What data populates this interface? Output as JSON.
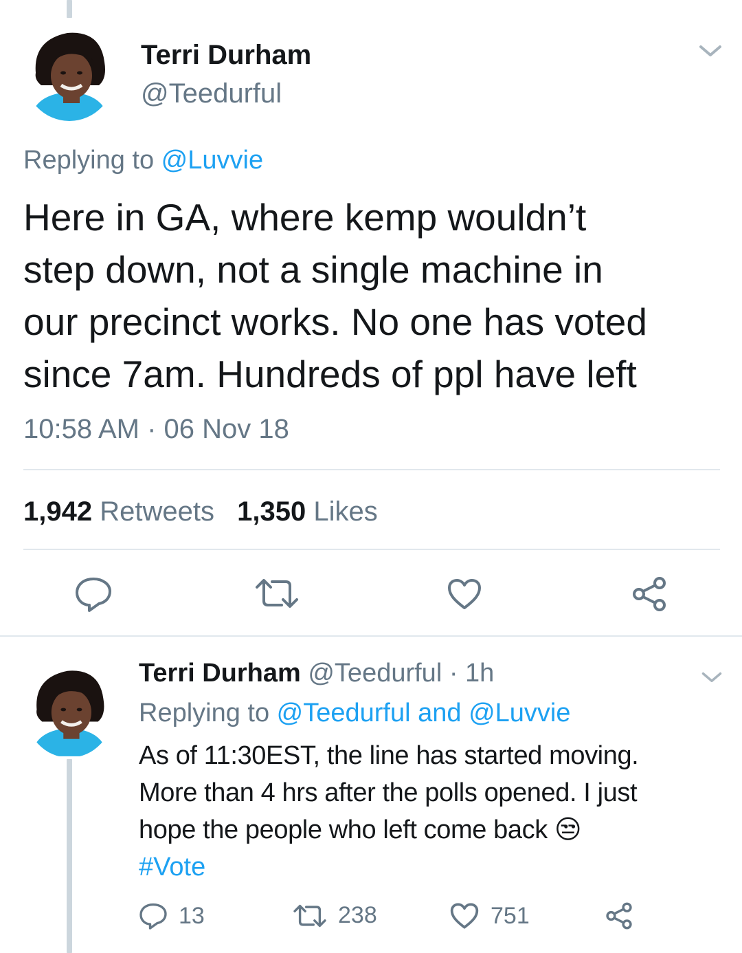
{
  "main_tweet": {
    "author_name": "Terri Durham",
    "author_handle": "@Teedurful",
    "replying_prefix": "Replying to ",
    "replying_to": "@Luvvie",
    "text_lines": [
      "Here in GA, where kemp wouldn’t",
      "step down, not a single machine in",
      "our precinct works. No one has voted",
      "since 7am. Hundreds of ppl have left"
    ],
    "timestamp": "10:58 AM · 06 Nov 18",
    "retweets_count": "1,942",
    "retweets_label": "Retweets",
    "likes_count": "1,350",
    "likes_label": "Likes",
    "actions": {
      "reply_icon": "reply-icon",
      "retweet_icon": "retweet-icon",
      "like_icon": "heart-icon",
      "share_icon": "share-icon"
    }
  },
  "reply_tweet": {
    "author_name": "Terri Durham",
    "author_handle": "@Teedurful",
    "time_ago": "· 1h",
    "replying_prefix": "Replying to ",
    "replying_to": "@Teedurful and @Luvvie",
    "text_lines": [
      "As of 11:30EST, the line has started moving.",
      "More than 4 hrs after the polls opened. I just",
      "hope the people who left come back"
    ],
    "emoji": "😒",
    "hashtag": "#Vote",
    "reply_count": "13",
    "retweet_count": "238",
    "like_count": "751"
  },
  "colors": {
    "accent": "#1da1f2",
    "muted": "#657786",
    "divider": "#e1e8ed",
    "thread_line": "#ccd6dd",
    "avatar_shirt": "#2bb3e6"
  }
}
